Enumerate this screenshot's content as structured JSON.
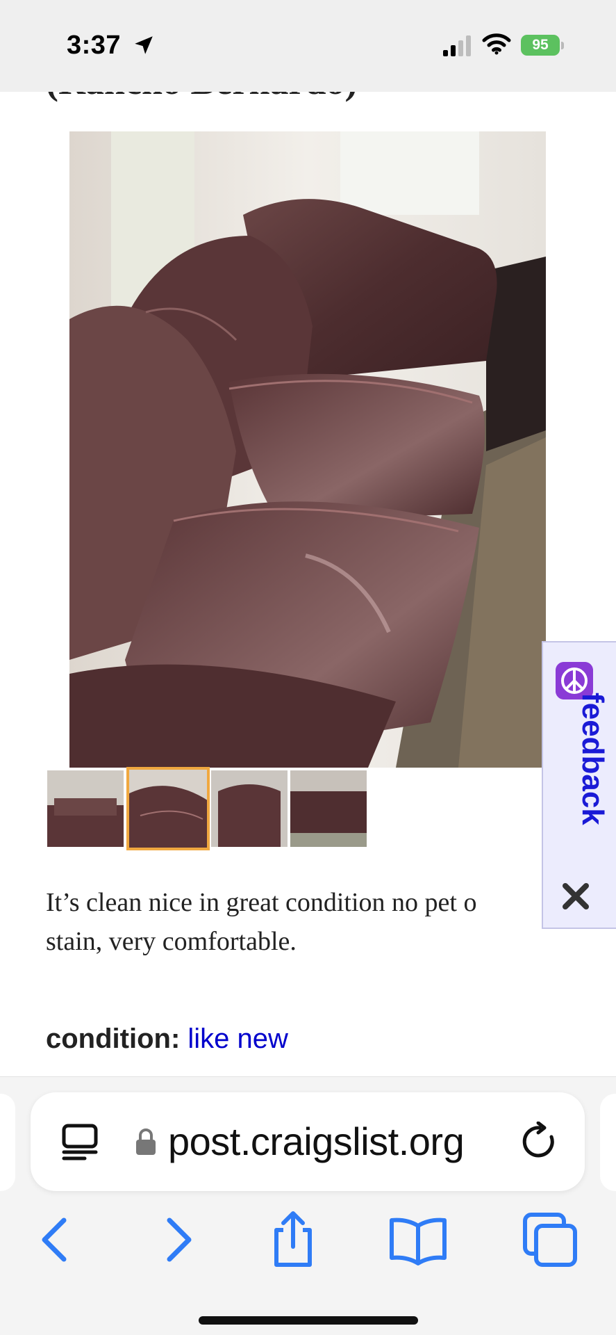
{
  "status_bar": {
    "time": "3:37",
    "battery": "95",
    "icons": [
      "location-arrow-icon",
      "cellular-signal-icon",
      "wifi-icon",
      "battery-icon"
    ]
  },
  "post": {
    "title_partial": "(Rancho Bernardo)",
    "image_alt": "brown leather sofa",
    "thumbnails_count": 4,
    "selected_thumbnail": 2,
    "description_line1": "It’s clean nice in great condition no pet o",
    "description_line2": "stain, very comfortable.",
    "attributes": [
      {
        "label": "condition:",
        "value": "like new"
      }
    ]
  },
  "feedback": {
    "label": "feedback",
    "icon": "peace-icon",
    "close_icon": "close-icon"
  },
  "browser": {
    "url": "post.craigslist.org",
    "icons": [
      "reader-icon",
      "lock-icon",
      "reload-icon",
      "back-icon",
      "forward-icon",
      "share-icon",
      "bookmarks-icon",
      "tabs-icon"
    ]
  },
  "colors": {
    "link": "#0000cc",
    "ios_blue": "#2f7cf6",
    "thumb_selected": "#f0a840",
    "battery": "#5cc15f",
    "feedback_text": "#1a1ad6",
    "feedback_bg": "#ececfd"
  }
}
